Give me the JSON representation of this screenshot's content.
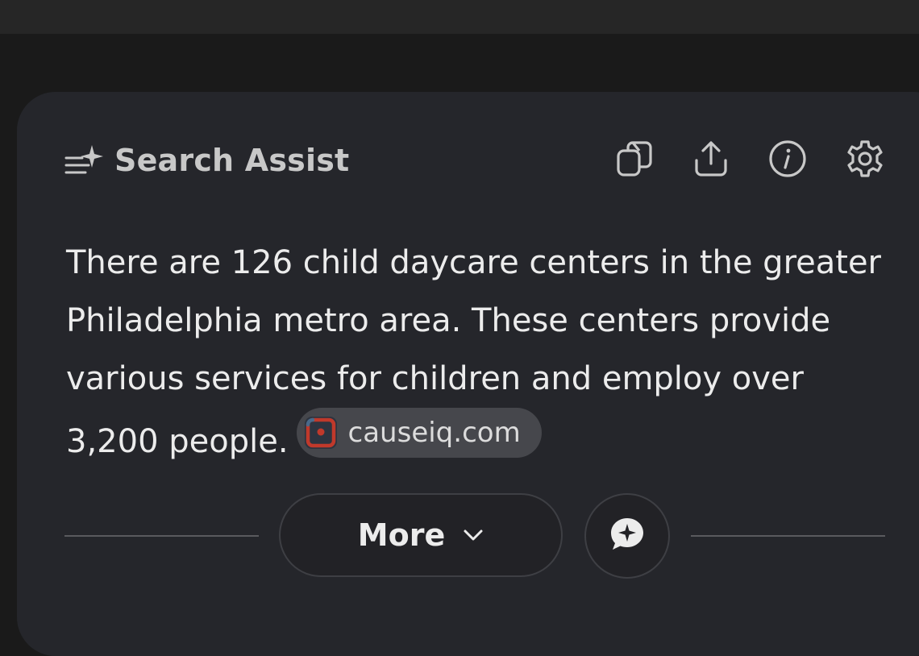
{
  "header": {
    "title": "Search Assist",
    "icon": "search-assist-sparkle-icon"
  },
  "toolbar": {
    "items": [
      {
        "icon": "copy-icon"
      },
      {
        "icon": "share-icon"
      },
      {
        "icon": "info-icon"
      },
      {
        "icon": "settings-gear-icon"
      }
    ]
  },
  "answer": {
    "text": "There are 126 child daycare centers in the greater Philadelphia metro area. These centers provide various services for children and employ over 3,200 people.",
    "source": {
      "label": "causeiq.com",
      "icon": "causeiq-favicon"
    }
  },
  "footer": {
    "more_label": "More",
    "more_icon": "chevron-down-icon",
    "chat_icon": "chat-sparkle-icon"
  },
  "colors": {
    "page_background": "#1a1a1a",
    "top_bar": "#262626",
    "card_background": "#25262b",
    "text_primary": "#ececec",
    "text_secondary": "#c8c8c8",
    "chip_background": "#46474c",
    "favicon_red": "#c0392b",
    "favicon_blue": "#4a6a8a"
  }
}
